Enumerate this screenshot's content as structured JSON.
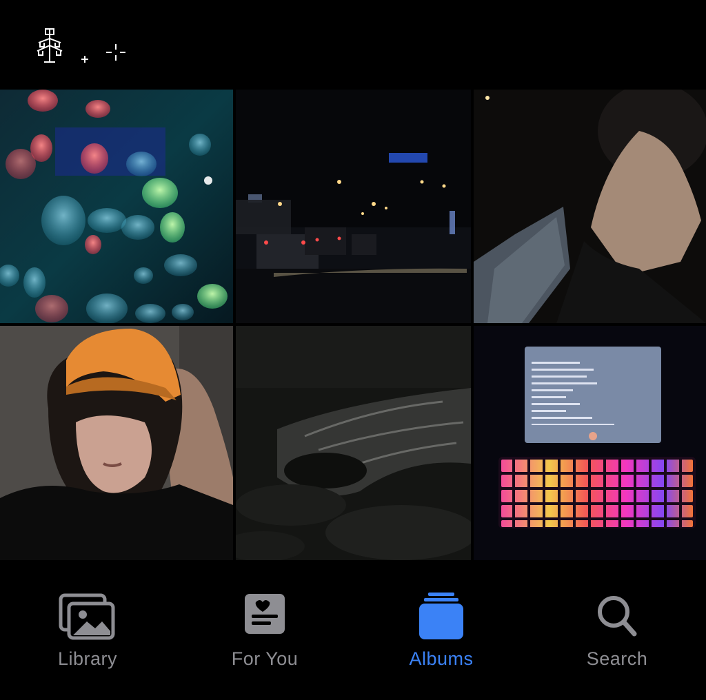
{
  "tabbar": {
    "tabs": [
      {
        "id": "library",
        "label": "Library",
        "icon": "photo-library-icon",
        "active": false
      },
      {
        "id": "for-you",
        "label": "For You",
        "icon": "for-you-icon",
        "active": false
      },
      {
        "id": "albums",
        "label": "Albums",
        "icon": "albums-stack-icon",
        "active": true
      },
      {
        "id": "search",
        "label": "Search",
        "icon": "magnifier-icon",
        "active": false
      }
    ]
  },
  "colors": {
    "background": "#000000",
    "inactive_tab": "#8e8e93",
    "active_tab": "#3b82f6"
  },
  "photos": [
    {
      "id": "jellyfish-aquarium"
    },
    {
      "id": "night-road"
    },
    {
      "id": "dark-hand-portrait"
    },
    {
      "id": "orange-cap-selfie"
    },
    {
      "id": "night-sea-waves"
    },
    {
      "id": "tablet-rgb-keyboard"
    }
  ]
}
